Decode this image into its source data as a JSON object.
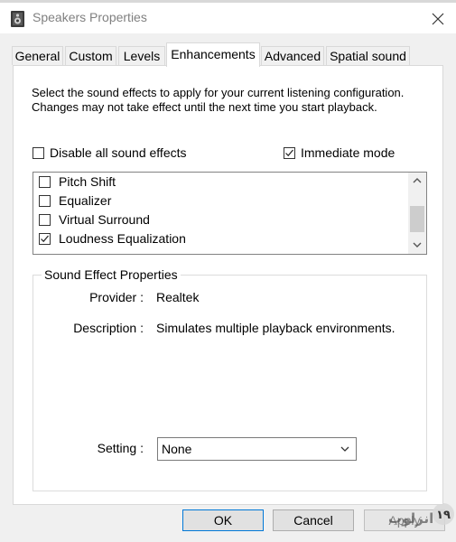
{
  "window": {
    "title": "Speakers Properties",
    "app_icon": "speaker-icon",
    "close_icon": "close-icon"
  },
  "tabs": [
    {
      "label": "General",
      "active": false
    },
    {
      "label": "Custom",
      "active": false
    },
    {
      "label": "Levels",
      "active": false
    },
    {
      "label": "Enhancements",
      "active": true
    },
    {
      "label": "Advanced",
      "active": false
    },
    {
      "label": "Spatial sound",
      "active": false
    }
  ],
  "enhancements": {
    "description": "Select the sound effects to apply for your current listening configuration. Changes may not take effect until the next time you start playback.",
    "disable_all": {
      "label": "Disable all sound effects",
      "checked": false
    },
    "immediate_mode": {
      "label": "Immediate mode",
      "checked": true
    },
    "effects": [
      {
        "label": "Pitch Shift",
        "checked": false
      },
      {
        "label": "Equalizer",
        "checked": false
      },
      {
        "label": "Virtual Surround",
        "checked": false
      },
      {
        "label": "Loudness Equalization",
        "checked": true
      }
    ],
    "properties": {
      "group_title": "Sound Effect Properties",
      "provider_label": "Provider :",
      "provider_value": "Realtek",
      "description_label": "Description :",
      "description_value": "Simulates multiple playback environments.",
      "setting_label": "Setting :",
      "setting_value": "None"
    }
  },
  "buttons": {
    "ok": "OK",
    "cancel": "Cancel",
    "apply": "Apply"
  },
  "watermark": {
    "text": "انزلوب",
    "icon": "watermark-logo-icon"
  },
  "colors": {
    "window_bg": "#f0f0f0",
    "panel_bg": "#ffffff",
    "focus_border": "#0078d7"
  }
}
